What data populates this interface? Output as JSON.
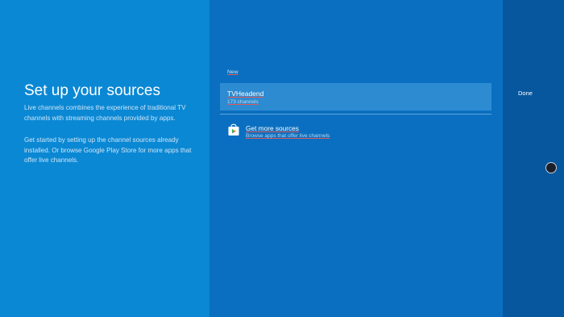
{
  "intro": {
    "title": "Set up your sources",
    "paragraph1": "Live channels combines the experience of traditional TV channels with streaming channels provided by apps.",
    "paragraph2": "Get started by setting up the channel sources already installed. Or browse Google Play Store for more apps that offer live channels."
  },
  "sources": {
    "section_label": "New",
    "items": [
      {
        "name": "TVHeadend",
        "count": "173 channels"
      }
    ]
  },
  "more_sources": {
    "title": "Get more sources",
    "subtitle": "Browse apps that offer live channels",
    "icon": "play-store-icon"
  },
  "actions": {
    "done_label": "Done"
  },
  "colors": {
    "left_panel": "#0a88d4",
    "middle_panel": "#0a6fc0",
    "right_panel": "#06579e",
    "selected_card": "#2d8bd2"
  }
}
